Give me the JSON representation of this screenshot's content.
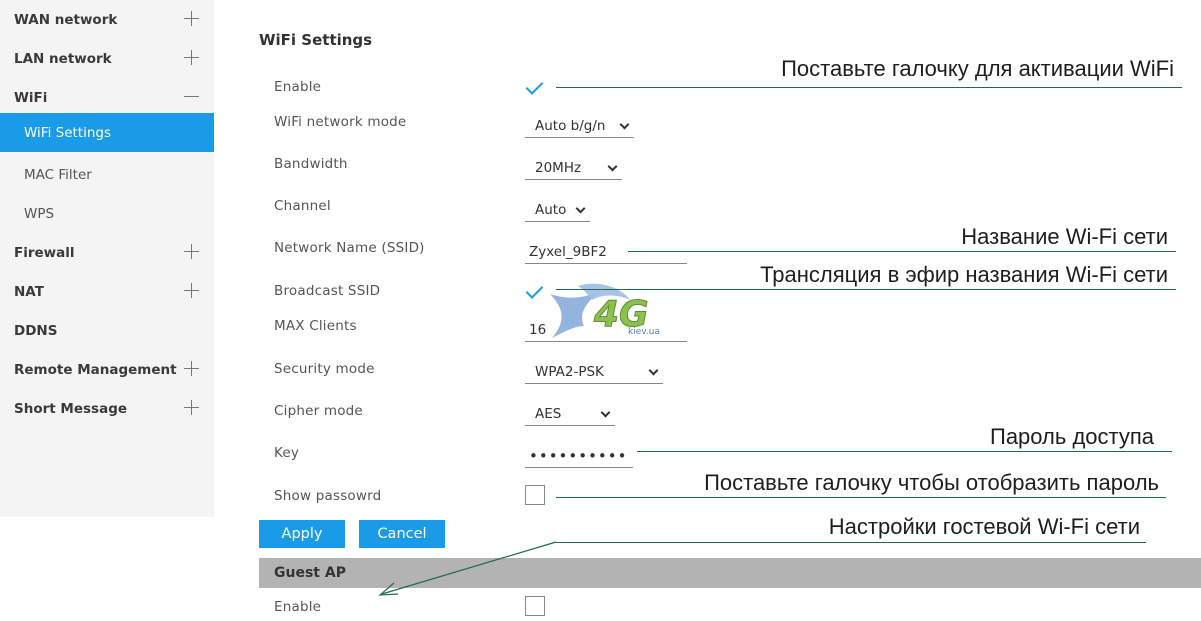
{
  "sidebar": {
    "items": [
      {
        "label": "WAN network",
        "toggle": "plus"
      },
      {
        "label": "LAN network",
        "toggle": "plus"
      },
      {
        "label": "WiFi",
        "toggle": "minus"
      },
      {
        "label": "WiFi Settings",
        "active": true
      },
      {
        "label": "MAC Filter"
      },
      {
        "label": "WPS"
      },
      {
        "label": "Firewall",
        "toggle": "plus"
      },
      {
        "label": "NAT",
        "toggle": "plus"
      },
      {
        "label": "DDNS"
      },
      {
        "label": "Remote Management",
        "toggle": "plus"
      },
      {
        "label": "Short Message",
        "toggle": "plus"
      }
    ]
  },
  "main": {
    "title": "WiFi Settings",
    "enable": {
      "label": "Enable",
      "checked": true
    },
    "mode": {
      "label": "WiFi network mode",
      "value": "Auto b/g/n"
    },
    "bandwidth": {
      "label": "Bandwidth",
      "value": "20MHz"
    },
    "channel": {
      "label": "Channel",
      "value": "Auto"
    },
    "ssid": {
      "label": "Network Name (SSID)",
      "value": "Zyxel_9BF2"
    },
    "broadcast": {
      "label": "Broadcast SSID",
      "checked": true
    },
    "max_clients": {
      "label": "MAX Clients",
      "value": "16"
    },
    "security": {
      "label": "Security mode",
      "value": "WPA2-PSK"
    },
    "cipher": {
      "label": "Cipher mode",
      "value": "AES"
    },
    "key": {
      "label": "Key",
      "value": "••••••••••"
    },
    "show_password": {
      "label": "Show passowrd",
      "checked": false
    },
    "apply_label": "Apply",
    "cancel_label": "Cancel",
    "guest": {
      "title": "Guest AP",
      "enable_label": "Enable",
      "enable_checked": false
    }
  },
  "annotations": {
    "enable": "Поставьте галочку для активации WiFi",
    "ssid": "Название Wi-Fi сети",
    "broadcast": "Трансляция в эфир названия Wi-Fi сети",
    "key": "Пароль доступа",
    "show_password": "Поставьте галочку чтобы отобразить пароль",
    "guest": "Настройки гостевой Wi-Fi сети"
  },
  "logo": {
    "main": "4G",
    "sub": "kiev.ua"
  },
  "colors": {
    "accent": "#1a9be8",
    "annotation_line": "#1f6b4a",
    "guest_bar": "#b3b3b3"
  }
}
